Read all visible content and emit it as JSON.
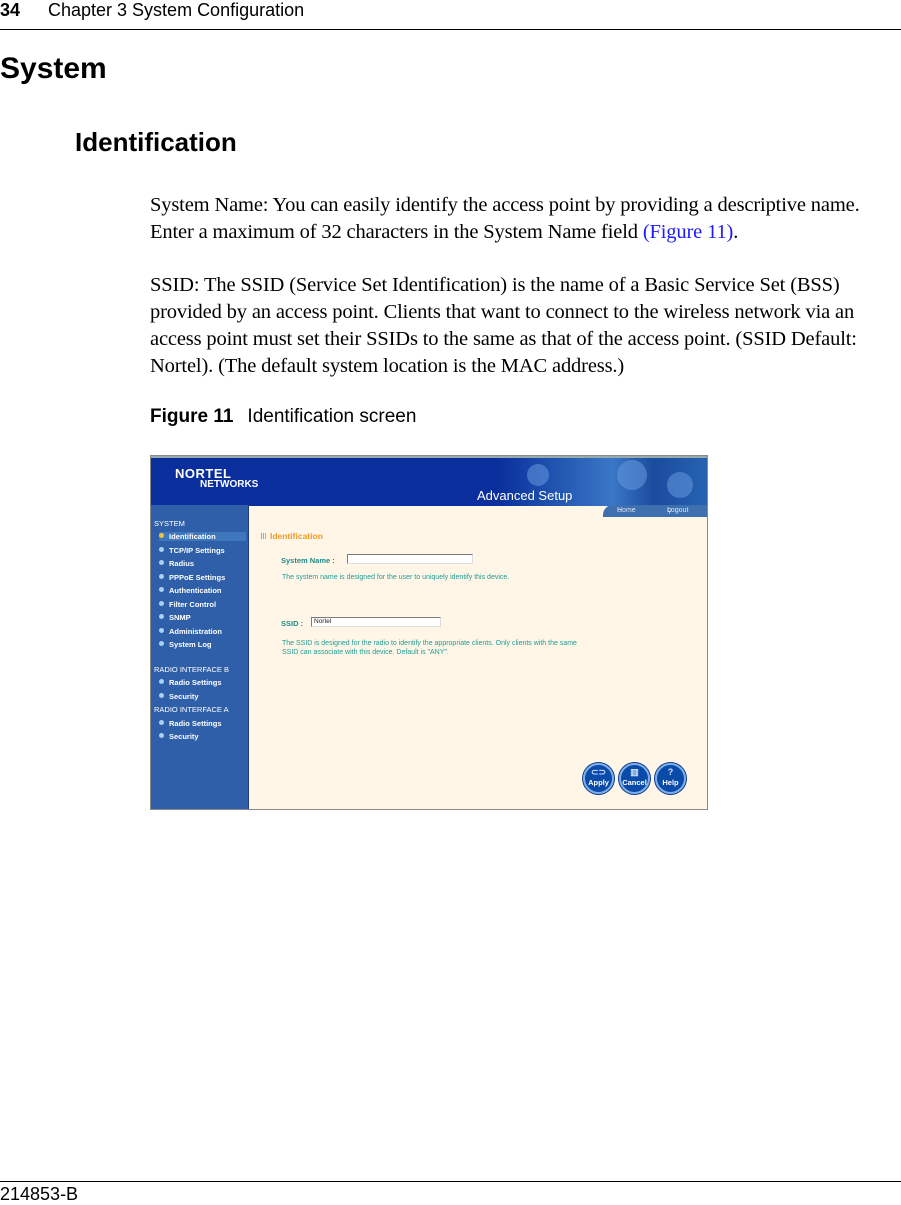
{
  "header": {
    "page_number": "34",
    "chapter": "Chapter 3  System Configuration"
  },
  "headings": {
    "section": "System",
    "subsection": "Identification"
  },
  "paragraphs": {
    "p1_text": "System Name: You can easily identify the access point by providing a descriptive name. Enter a maximum of 32 characters in the System Name field ",
    "p1_link": "(Figure 11)",
    "p1_end": ".",
    "p2_text": "SSID: The SSID (Service Set Identification) is the name of a Basic Service Set (BSS) provided by an access point. Clients that want to connect to the wireless network via an access point must set their SSIDs to the same as that of the access point. (SSID Default: Nortel). (The default system location is the MAC address.)"
  },
  "figure": {
    "label": "Figure 11",
    "caption": "Identification screen",
    "ui": {
      "logo_line1": "NORTEL",
      "logo_line2": "NETWORKS",
      "banner_title": "Advanced Setup",
      "home_link": "Home",
      "logout_link": "Logout",
      "nav": {
        "sections": [
          {
            "title": "SYSTEM",
            "items": [
              "Identification",
              "TCP/IP Settings",
              "Radius",
              "PPPoE Settings",
              "Authentication",
              "Filter Control",
              "SNMP",
              "Administration",
              "System Log"
            ]
          },
          {
            "title": "RADIO INTERFACE B",
            "items": [
              "Radio Settings",
              "Security"
            ]
          },
          {
            "title": "RADIO INTERFACE A",
            "items": [
              "Radio Settings",
              "Security"
            ]
          }
        ],
        "active_item": "Identification"
      },
      "page_title": "Identification",
      "system_name_label": "System Name :",
      "system_name_value": "",
      "system_name_help": "The system name is designed for the user to uniquely identify this device.",
      "ssid_label": "SSID :",
      "ssid_value": "Nortel",
      "ssid_help_line1": "The SSID is designed for the radio to identify the appropriate clients. Only clients with the same",
      "ssid_help_line2": "SSID can associate with this device. Default is \"ANY\".",
      "buttons": {
        "apply": "Apply",
        "cancel": "Cancel",
        "help": "Help"
      },
      "colors": {
        "banner": "#0a2f9c",
        "nav": "#2e5fa8",
        "content_bg": "#fff6e8",
        "title_orange": "#f39a1e",
        "label_teal": "#1e8c86"
      }
    }
  },
  "footer": {
    "doc_number": "214853-B"
  }
}
